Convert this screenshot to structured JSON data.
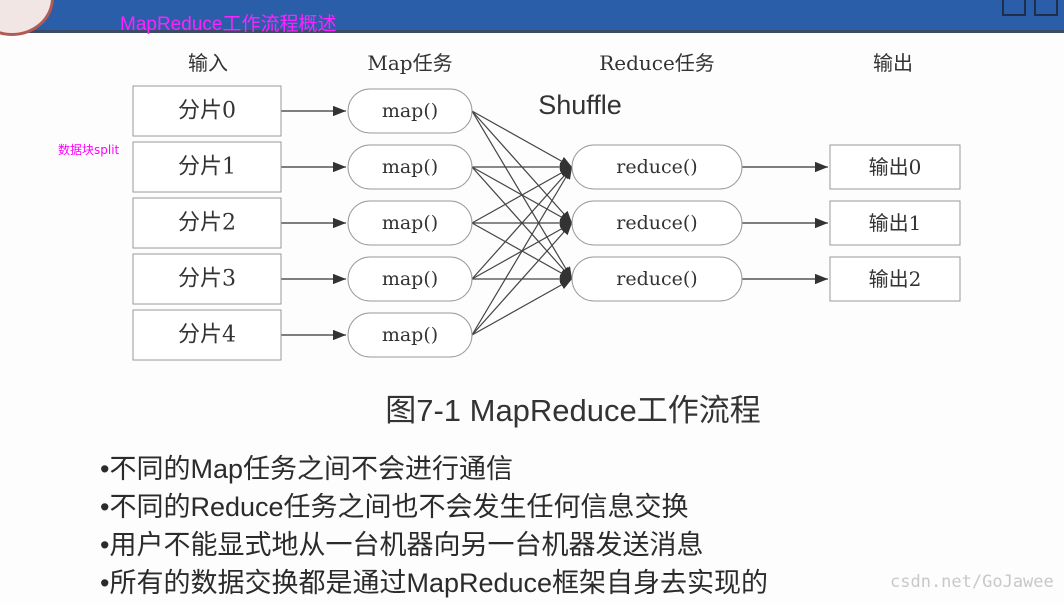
{
  "header": {
    "title": "MapReduce工作流程概述",
    "background": "#2a5ea9",
    "title_color": "#ff22ff"
  },
  "diagram": {
    "column_headers": [
      "输入",
      "Map任务",
      "Reduce任务",
      "输出"
    ],
    "inputs": [
      "分片0",
      "分片1",
      "分片2",
      "分片3",
      "分片4"
    ],
    "maps": [
      "map()",
      "map()",
      "map()",
      "map()",
      "map()"
    ],
    "reduces": [
      "reduce()",
      "reduce()",
      "reduce()"
    ],
    "outputs": [
      "输出0",
      "输出1",
      "输出2"
    ],
    "shuffle_label": "Shuffle",
    "side_note": "数据块split",
    "caption": "图7-1 MapReduce工作流程"
  },
  "bullets": [
    "•不同的Map任务之间不会进行通信",
    "•不同的Reduce任务之间也不会发生任何信息交换",
    "•用户不能显式地从一台机器向另一台机器发送消息",
    "•所有的数据交换都是通过MapReduce框架自身去实现的"
  ],
  "watermark": "csdn.net/GoJawee"
}
